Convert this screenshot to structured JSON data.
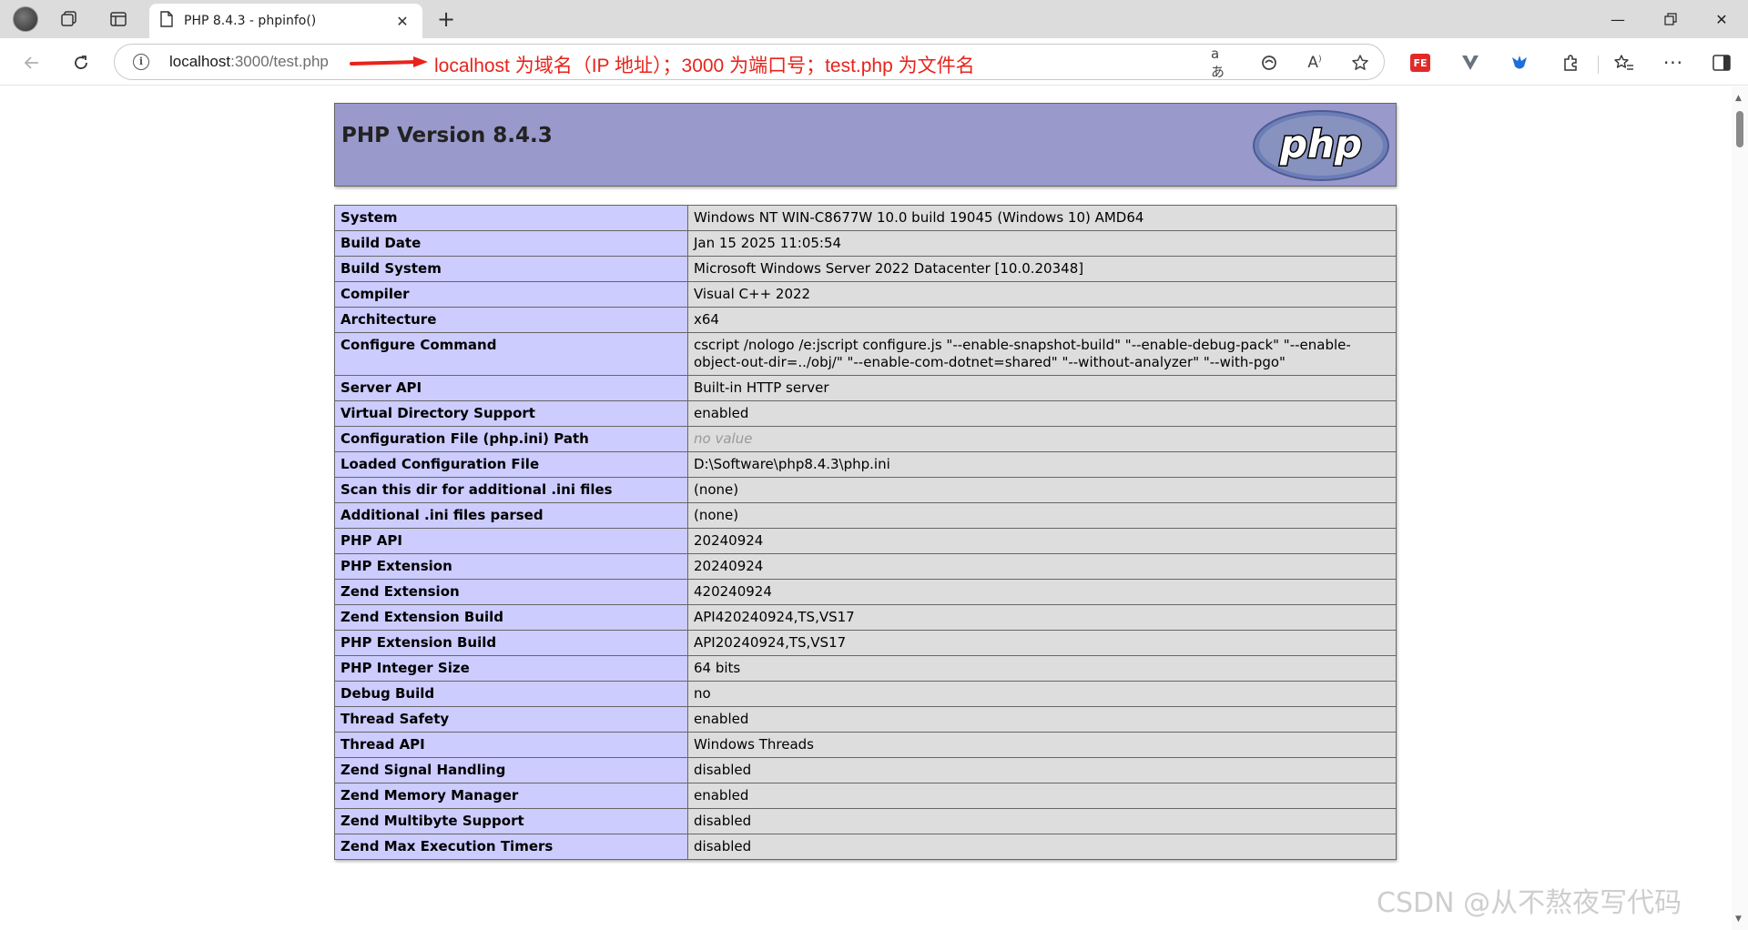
{
  "browser": {
    "tab_title": "PHP 8.4.3 - phpinfo()",
    "url_host": "localhost",
    "url_rest": ":3000/test.php",
    "annotation": "localhost 为域名（IP 地址）；3000 为端口号；test.php 为文件名",
    "annotation_color": "#e8231b",
    "toolbar_icons": [
      "read-aloud-icon",
      "refresh-page-icon",
      "font-icon",
      "favorite-star-icon",
      "fe-extension-icon",
      "v-extension-icon",
      "bird-extension-icon",
      "extensions-puzzle-icon",
      "favorites-icon",
      "more-icon",
      "sidebar-icon"
    ]
  },
  "phpinfo": {
    "version_title": "PHP Version 8.4.3",
    "logo_text": "php",
    "rows": [
      {
        "key": "System",
        "value": "Windows NT WIN-C8677W 10.0 build 19045 (Windows 10) AMD64"
      },
      {
        "key": "Build Date",
        "value": "Jan 15 2025 11:05:54"
      },
      {
        "key": "Build System",
        "value": "Microsoft Windows Server 2022 Datacenter [10.0.20348]"
      },
      {
        "key": "Compiler",
        "value": "Visual C++ 2022"
      },
      {
        "key": "Architecture",
        "value": "x64"
      },
      {
        "key": "Configure Command",
        "value": "cscript /nologo /e:jscript configure.js \"--enable-snapshot-build\" \"--enable-debug-pack\" \"--enable-object-out-dir=../obj/\" \"--enable-com-dotnet=shared\" \"--without-analyzer\" \"--with-pgo\""
      },
      {
        "key": "Server API",
        "value": "Built-in HTTP server"
      },
      {
        "key": "Virtual Directory Support",
        "value": "enabled"
      },
      {
        "key": "Configuration File (php.ini) Path",
        "value": "no value",
        "italic": true
      },
      {
        "key": "Loaded Configuration File",
        "value": "D:\\Software\\php8.4.3\\php.ini"
      },
      {
        "key": "Scan this dir for additional .ini files",
        "value": "(none)"
      },
      {
        "key": "Additional .ini files parsed",
        "value": "(none)"
      },
      {
        "key": "PHP API",
        "value": "20240924"
      },
      {
        "key": "PHP Extension",
        "value": "20240924"
      },
      {
        "key": "Zend Extension",
        "value": "420240924"
      },
      {
        "key": "Zend Extension Build",
        "value": "API420240924,TS,VS17"
      },
      {
        "key": "PHP Extension Build",
        "value": "API20240924,TS,VS17"
      },
      {
        "key": "PHP Integer Size",
        "value": "64 bits"
      },
      {
        "key": "Debug Build",
        "value": "no"
      },
      {
        "key": "Thread Safety",
        "value": "enabled"
      },
      {
        "key": "Thread API",
        "value": "Windows Threads"
      },
      {
        "key": "Zend Signal Handling",
        "value": "disabled"
      },
      {
        "key": "Zend Memory Manager",
        "value": "enabled"
      },
      {
        "key": "Zend Multibyte Support",
        "value": "disabled"
      },
      {
        "key": "Zend Max Execution Timers",
        "value": "disabled"
      }
    ]
  },
  "watermark": "CSDN @从不熬夜写代码",
  "colors": {
    "header_bg": "#9999cc",
    "key_bg": "#ccccff",
    "value_bg": "#dddddd"
  }
}
